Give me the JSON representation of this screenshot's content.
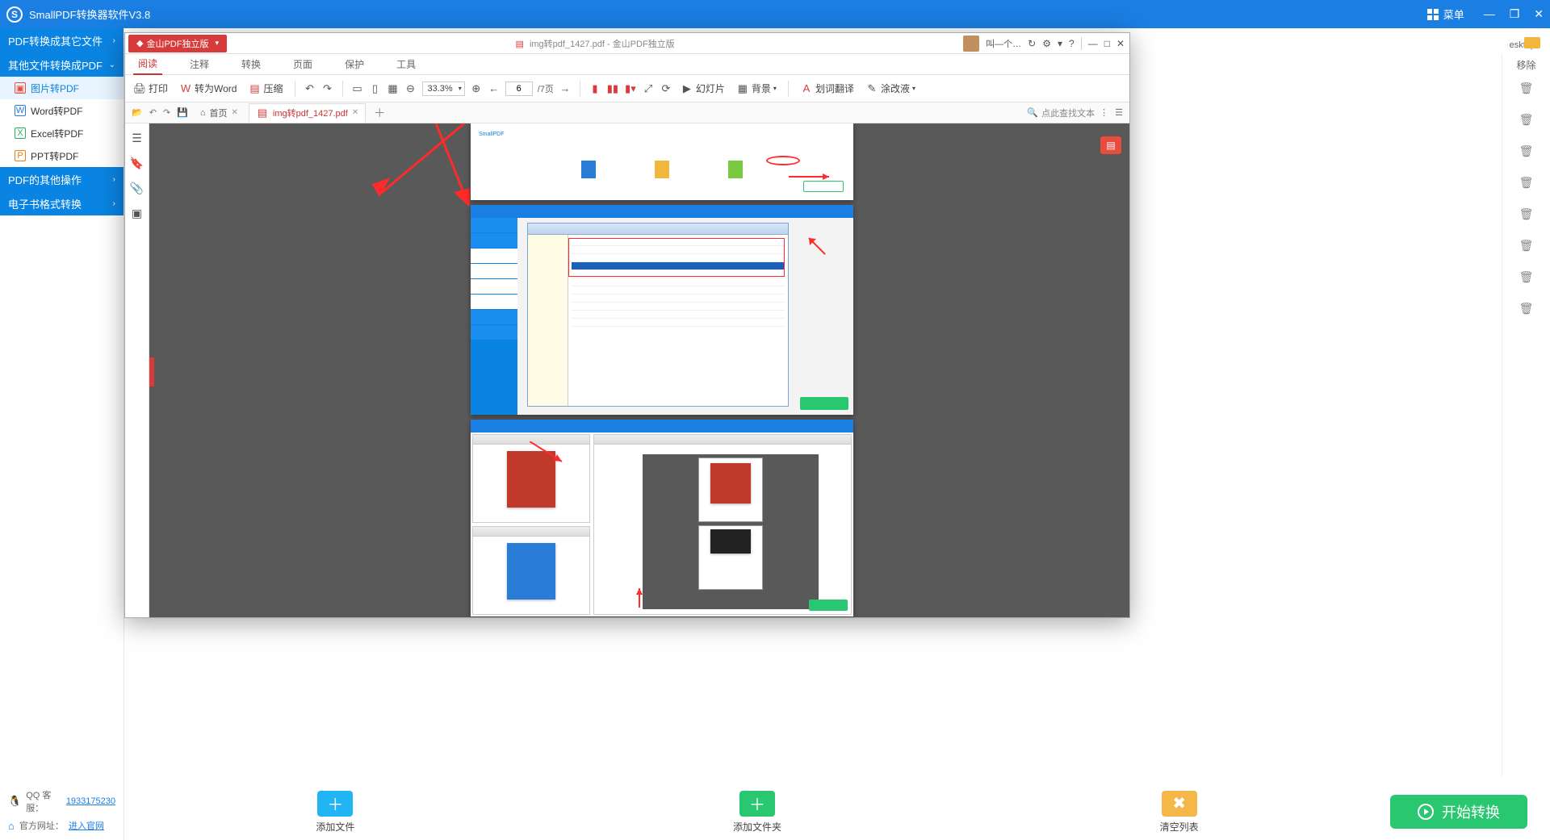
{
  "app": {
    "title": "SmallPDF转换器软件V3.8",
    "menu": "菜单"
  },
  "sidebar": {
    "cats": [
      {
        "label": "PDF转换成其它文件"
      },
      {
        "label": "其他文件转换成PDF"
      },
      {
        "label": "PDF的其他操作"
      },
      {
        "label": "电子书格式转换"
      }
    ],
    "items": [
      {
        "label": "图片转PDF"
      },
      {
        "label": "Word转PDF"
      },
      {
        "label": "Excel转PDF"
      },
      {
        "label": "PPT转PDF"
      }
    ],
    "qq_label": "QQ 客服：",
    "qq": "1933175230",
    "site_label": "官方网址：",
    "site": "进入官网"
  },
  "bottom": {
    "add_file": "添加文件",
    "add_folder": "添加文件夹",
    "clear": "清空列表",
    "start": "开始转换"
  },
  "pdfwin": {
    "badge": "金山PDF独立版",
    "doc_title": "img转pdf_1427.pdf - 金山PDF独立版",
    "user": "叫—个…",
    "menus": [
      "阅读",
      "注释",
      "转换",
      "页面",
      "保护",
      "工具"
    ],
    "toolbar": {
      "print": "打印",
      "to_word": "转为Word",
      "compress": "压缩",
      "zoom": "33.3%",
      "page": "6",
      "page_total": "/7页",
      "slideshow": "幻灯片",
      "background": "背景",
      "translate": "划词翻译",
      "erase": "涂改液"
    },
    "tabs": {
      "home": "首页",
      "file": "img转pdf_1427.pdf",
      "search": "点此查找文本"
    }
  },
  "delcol": {
    "header": "移除"
  },
  "desktop": {
    "label": "esktop"
  }
}
